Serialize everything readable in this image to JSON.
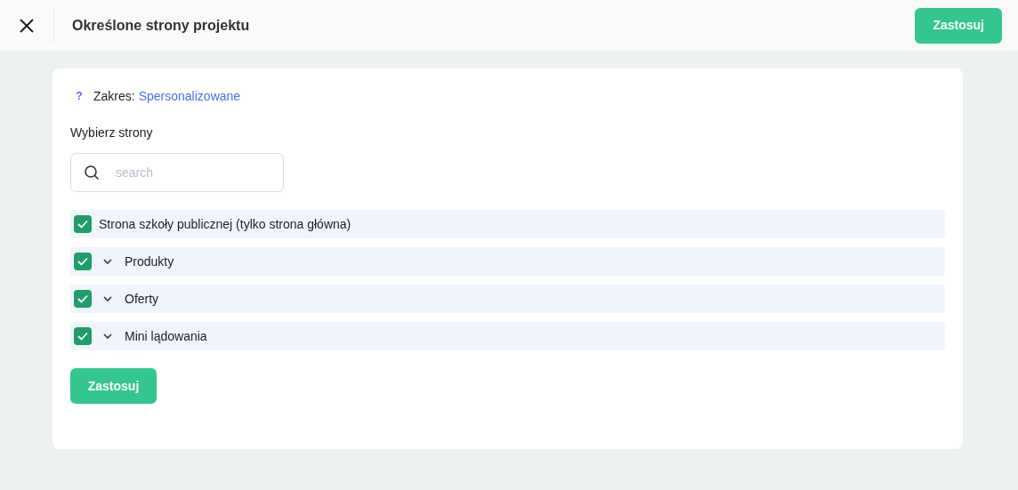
{
  "header": {
    "title": "Określone strony projektu",
    "apply_button": "Zastosuj"
  },
  "scope": {
    "help": "?",
    "label": "Zakres:",
    "value": "Spersonalizowane"
  },
  "pages_label": "Wybierz strony",
  "search": {
    "placeholder": "search"
  },
  "pages": [
    {
      "kind": "leaf",
      "label": "Strona szkoły publicznej (tylko strona główna)",
      "checked": true
    },
    {
      "kind": "group",
      "label": "Produkty",
      "checked": true,
      "expanded": false
    },
    {
      "kind": "group",
      "label": "Oferty",
      "checked": true,
      "expanded": false
    },
    {
      "kind": "group",
      "label": "Mini lądowania",
      "checked": true,
      "expanded": false
    }
  ],
  "apply_button": "Zastosuj"
}
